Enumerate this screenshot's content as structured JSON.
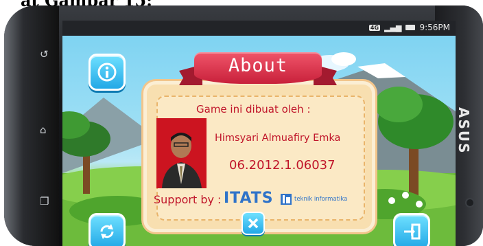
{
  "caption": "at Gambar 15:",
  "statusbar": {
    "network": "4G",
    "time": "9:56PM"
  },
  "brand": "ASUS",
  "dialog": {
    "title": "About",
    "made_by_label": "Game ini dibuat oleh :",
    "author_name": "Himsyari Almuafiry Emka",
    "student_id": "06.2012.1.06037",
    "support_label": "Support by :",
    "org_name": "ITATS",
    "org_sub": "teknik informatika"
  },
  "icons": {
    "info": "info-icon",
    "refresh": "refresh-icon",
    "close": "close-icon",
    "exit": "exit-icon"
  }
}
